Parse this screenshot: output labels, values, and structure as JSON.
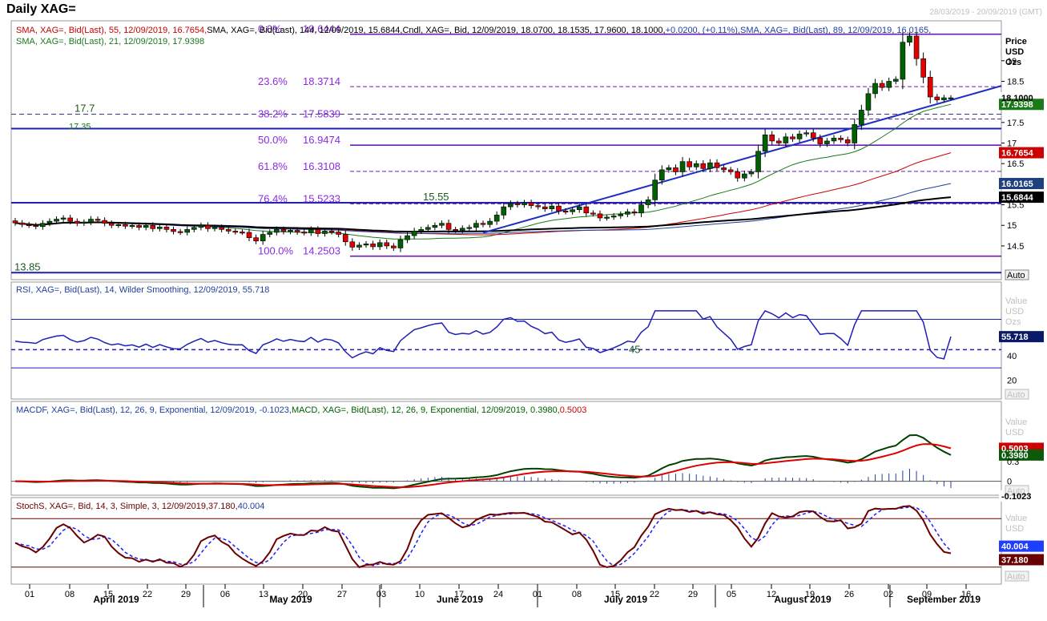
{
  "window": {
    "title": "Daily XAG=",
    "date_range": "28/03/2019 - 20/09/2019 (GMT)"
  },
  "price_panel": {
    "legend_line1": [
      {
        "text": "SMA, XAG=, Bid(Last),   55, 12/09/2019, 16.7654, ",
        "color": "#cc0000"
      },
      {
        "text": "SMA, XAG=, Bid(Last),   144, 12/09/2019, 15.6844, ",
        "color": "#000000"
      },
      {
        "text": "Cndl, XAG=, Bid, 12/09/2019, 18.0700, 18.1535, 17.9600, 18.1000, ",
        "color": "#000000"
      },
      {
        "text": "+0.0200, (+0.11%), ",
        "color": "#1f3f9f"
      },
      {
        "text": "SMA, XAG=, Bid(Last),   89, 12/09/2019, 16.0165,",
        "color": "#1f3f9f"
      }
    ],
    "legend_line2": "SMA, XAG=, Bid(Last),   21, 12/09/2019, 17.9398",
    "axis_header": [
      "Price",
      "USD",
      "Ozs"
    ],
    "y_ticks": [
      "19",
      "18.5",
      "17.5",
      "17",
      "16.5",
      "15.5",
      "15",
      "14.5"
    ],
    "value_tags": [
      {
        "label": "18.1000",
        "value": 18.1,
        "bg": "#ffffff",
        "fg": "#000000"
      },
      {
        "label": "17.9398",
        "value": 17.9398,
        "bg": "#1a7a1a",
        "fg": "#ffffff"
      },
      {
        "label": "16.7654",
        "value": 16.7654,
        "bg": "#cc0000",
        "fg": "#ffffff"
      },
      {
        "label": "16.0165",
        "value": 16.0165,
        "bg": "#1f3f7f",
        "fg": "#ffffff"
      },
      {
        "label": "15.6844",
        "value": 15.6844,
        "bg": "#000000",
        "fg": "#ffffff"
      }
    ],
    "fib_levels": [
      {
        "pct": "0.0%",
        "value": 19.6444,
        "label": "19.6444",
        "solid": true
      },
      {
        "pct": "23.6%",
        "value": 18.3714,
        "label": "18.3714",
        "solid": false
      },
      {
        "pct": "38.2%",
        "value": 17.5839,
        "label": "17.5839",
        "solid": false
      },
      {
        "pct": "50.0%",
        "value": 16.9474,
        "label": "16.9474",
        "solid": true
      },
      {
        "pct": "61.8%",
        "value": 16.3108,
        "label": "16.3108",
        "solid": false
      },
      {
        "pct": "76.4%",
        "value": 15.5233,
        "label": "15.5233",
        "solid": false
      },
      {
        "pct": "100.0%",
        "value": 14.2503,
        "label": "14.2503",
        "solid": true
      }
    ],
    "horizontal_levels": [
      {
        "value": 17.7,
        "label": "17.7"
      },
      {
        "value": 17.35,
        "label": "17.35"
      },
      {
        "value": 15.55,
        "label": "15.55"
      },
      {
        "value": 13.85,
        "label": "13.85"
      }
    ],
    "auto_button": "Auto"
  },
  "rsi_panel": {
    "legend": "RSI, XAG=, Bid(Last),   14, Wilder Smoothing, 12/09/2019, 55.718",
    "axis_header": [
      "Value",
      "USD",
      "Ozs"
    ],
    "y_ticks": [
      "40",
      "20"
    ],
    "level_label": "45",
    "current_tag": "55.718",
    "auto_button": "Auto"
  },
  "macd_panel": {
    "legend_parts": [
      {
        "text": "MACDF, XAG=, Bid(Last),   12, 26, 9, Exponential, 12/09/2019, -0.1023, ",
        "color": "#1f3f9f"
      },
      {
        "text": "MACD, XAG=, Bid(Last),   12, 26, 9, Exponential, 12/09/2019, 0.3980, ",
        "color": "#006000"
      },
      {
        "text": "0.5003",
        "color": "#cc0000"
      }
    ],
    "axis_header": [
      "Value",
      "USD"
    ],
    "y_ticks": [
      "0.3",
      "0"
    ],
    "tags": [
      {
        "label": "0.5003",
        "bg": "#cc0000",
        "fg": "#ffffff"
      },
      {
        "label": "0.3980",
        "bg": "#0a5a0a",
        "fg": "#ffffff"
      },
      {
        "label": "-0.1023",
        "bg": "#ffffff",
        "fg": "#000000"
      }
    ],
    "auto_button": "Auto"
  },
  "stoch_panel": {
    "legend_parts": [
      {
        "text": "StochS, XAG=, Bid,   14, 3, Simple, 3, 12/09/2019, ",
        "color": "#6a0000"
      },
      {
        "text": "37.180, ",
        "color": "#6a0000"
      },
      {
        "text": "40.004",
        "color": "#1f3f9f"
      }
    ],
    "axis_header": [
      "Value",
      "USD"
    ],
    "tags": [
      {
        "label": "40.004",
        "bg": "#1f3fff",
        "fg": "#ffffff"
      },
      {
        "label": "37.180",
        "bg": "#6a0000",
        "fg": "#ffffff"
      }
    ],
    "auto_button": "Auto"
  },
  "x_axis": {
    "day_ticks": [
      "01",
      "08",
      "15",
      "22",
      "29",
      "06",
      "13",
      "20",
      "27",
      "03",
      "10",
      "17",
      "24",
      "01",
      "08",
      "15",
      "22",
      "29",
      "05",
      "12",
      "19",
      "26",
      "02",
      "09",
      "16"
    ],
    "months": [
      "April 2019",
      "May 2019",
      "June 2019",
      "July 2019",
      "August 2019",
      "September 2019"
    ]
  },
  "chart_data": {
    "type": "candlestick",
    "title": "Daily XAG=",
    "x_range": [
      "28/03/2019",
      "20/09/2019"
    ],
    "price_ylim": [
      13.7,
      19.95
    ],
    "fib_retracement": {
      "high": 19.6444,
      "low": 14.2503
    },
    "sma": [
      {
        "name": "SMA 21",
        "last": 17.9398,
        "color": "#1a7a1a"
      },
      {
        "name": "SMA 55",
        "last": 16.7654,
        "color": "#cc0000"
      },
      {
        "name": "SMA 89",
        "last": 16.0165,
        "color": "#1f3f9f"
      },
      {
        "name": "SMA 144",
        "last": 15.6844,
        "color": "#000000"
      }
    ],
    "candles_close": [
      15.06,
      15.02,
      15.0,
      14.97,
      15.05,
      15.1,
      15.15,
      15.18,
      15.1,
      15.05,
      15.08,
      15.15,
      15.12,
      15.05,
      15.0,
      15.02,
      14.98,
      15.0,
      14.95,
      15.0,
      14.92,
      14.96,
      14.9,
      14.85,
      14.83,
      14.9,
      14.95,
      15.0,
      14.92,
      14.95,
      14.9,
      14.86,
      14.84,
      14.83,
      14.7,
      14.62,
      14.78,
      14.83,
      14.9,
      14.85,
      14.88,
      14.84,
      14.82,
      14.9,
      14.8,
      14.86,
      14.84,
      14.78,
      14.6,
      14.47,
      14.52,
      14.55,
      14.48,
      14.58,
      14.5,
      14.45,
      14.65,
      14.75,
      14.86,
      14.9,
      14.95,
      15.0,
      15.05,
      14.9,
      14.88,
      14.93,
      14.95,
      15.05,
      15.02,
      15.1,
      15.25,
      15.45,
      15.53,
      15.5,
      15.55,
      15.48,
      15.45,
      15.4,
      15.47,
      15.35,
      15.33,
      15.38,
      15.45,
      15.3,
      15.28,
      15.18,
      15.2,
      15.23,
      15.27,
      15.33,
      15.3,
      15.5,
      15.62,
      16.1,
      16.35,
      16.4,
      16.3,
      16.55,
      16.42,
      16.5,
      16.38,
      16.52,
      16.4,
      16.35,
      16.3,
      16.15,
      16.25,
      16.3,
      16.8,
      17.2,
      17.05,
      17.0,
      17.15,
      17.1,
      17.22,
      17.25,
      17.12,
      16.98,
      17.05,
      17.12,
      17.08,
      17.0,
      17.45,
      17.8,
      18.2,
      18.45,
      18.35,
      18.5,
      18.55,
      19.45,
      19.6,
      19.05,
      18.6,
      18.12,
      18.05,
      18.1,
      18.1
    ],
    "rsi": {
      "period": 14,
      "last": 55.718,
      "levels": [
        70,
        45,
        30
      ]
    },
    "macd": {
      "fast": 12,
      "slow": 26,
      "signal": 9,
      "macd": 0.398,
      "signal_value": 0.5003,
      "histogram": -0.1023
    },
    "stochastic": {
      "k_period": 14,
      "smooth": 3,
      "d_period": 3,
      "k": 37.18,
      "d": 40.004,
      "levels": [
        80,
        20
      ]
    }
  }
}
